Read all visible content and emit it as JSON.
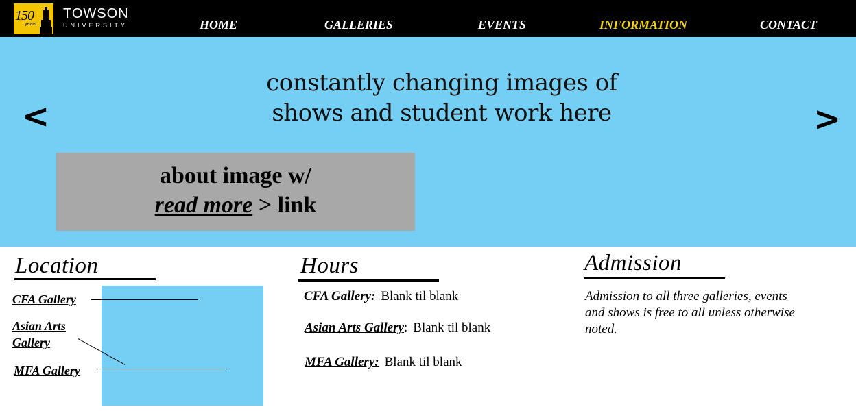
{
  "header": {
    "logo": {
      "badge_number": "150",
      "badge_caption": "years",
      "name": "TOWSON",
      "subname": "UNIVERSITY"
    },
    "nav": [
      {
        "label": "HOME",
        "active": false
      },
      {
        "label": "GALLERIES",
        "active": false
      },
      {
        "label": "EVENTS",
        "active": false
      },
      {
        "label": "INFORMATION",
        "active": true
      },
      {
        "label": "CONTACT",
        "active": false
      }
    ],
    "colors": {
      "bar": "#000000",
      "active": "#f2d21b",
      "text": "#ffffff",
      "badge": "#f2c500"
    }
  },
  "hero": {
    "line1": "constantly changing images of",
    "line2": "shows and student work here",
    "prev_label": "<",
    "next_label": ">",
    "about_line1": "about image w/",
    "read_more": "read more",
    "link_suffix": "> link",
    "background": "#75cef3"
  },
  "location": {
    "title": "Location",
    "galleries": [
      {
        "label": "CFA Gallery"
      },
      {
        "label_line1": "Asian Arts",
        "label_line2": "Gallery"
      },
      {
        "label": "MFA Gallery"
      }
    ]
  },
  "hours": {
    "title": "Hours",
    "rows": [
      {
        "label": "CFA Gallery:",
        "value": "Blank til blank"
      },
      {
        "label": "Asian Arts Gallery",
        "colon": ":",
        "value": "Blank til blank"
      },
      {
        "label": "MFA Gallery:",
        "value": "Blank til blank"
      }
    ]
  },
  "admission": {
    "title": "Admission",
    "text": "Admission to all three galleries, events and shows is free to all unless otherwise noted."
  }
}
